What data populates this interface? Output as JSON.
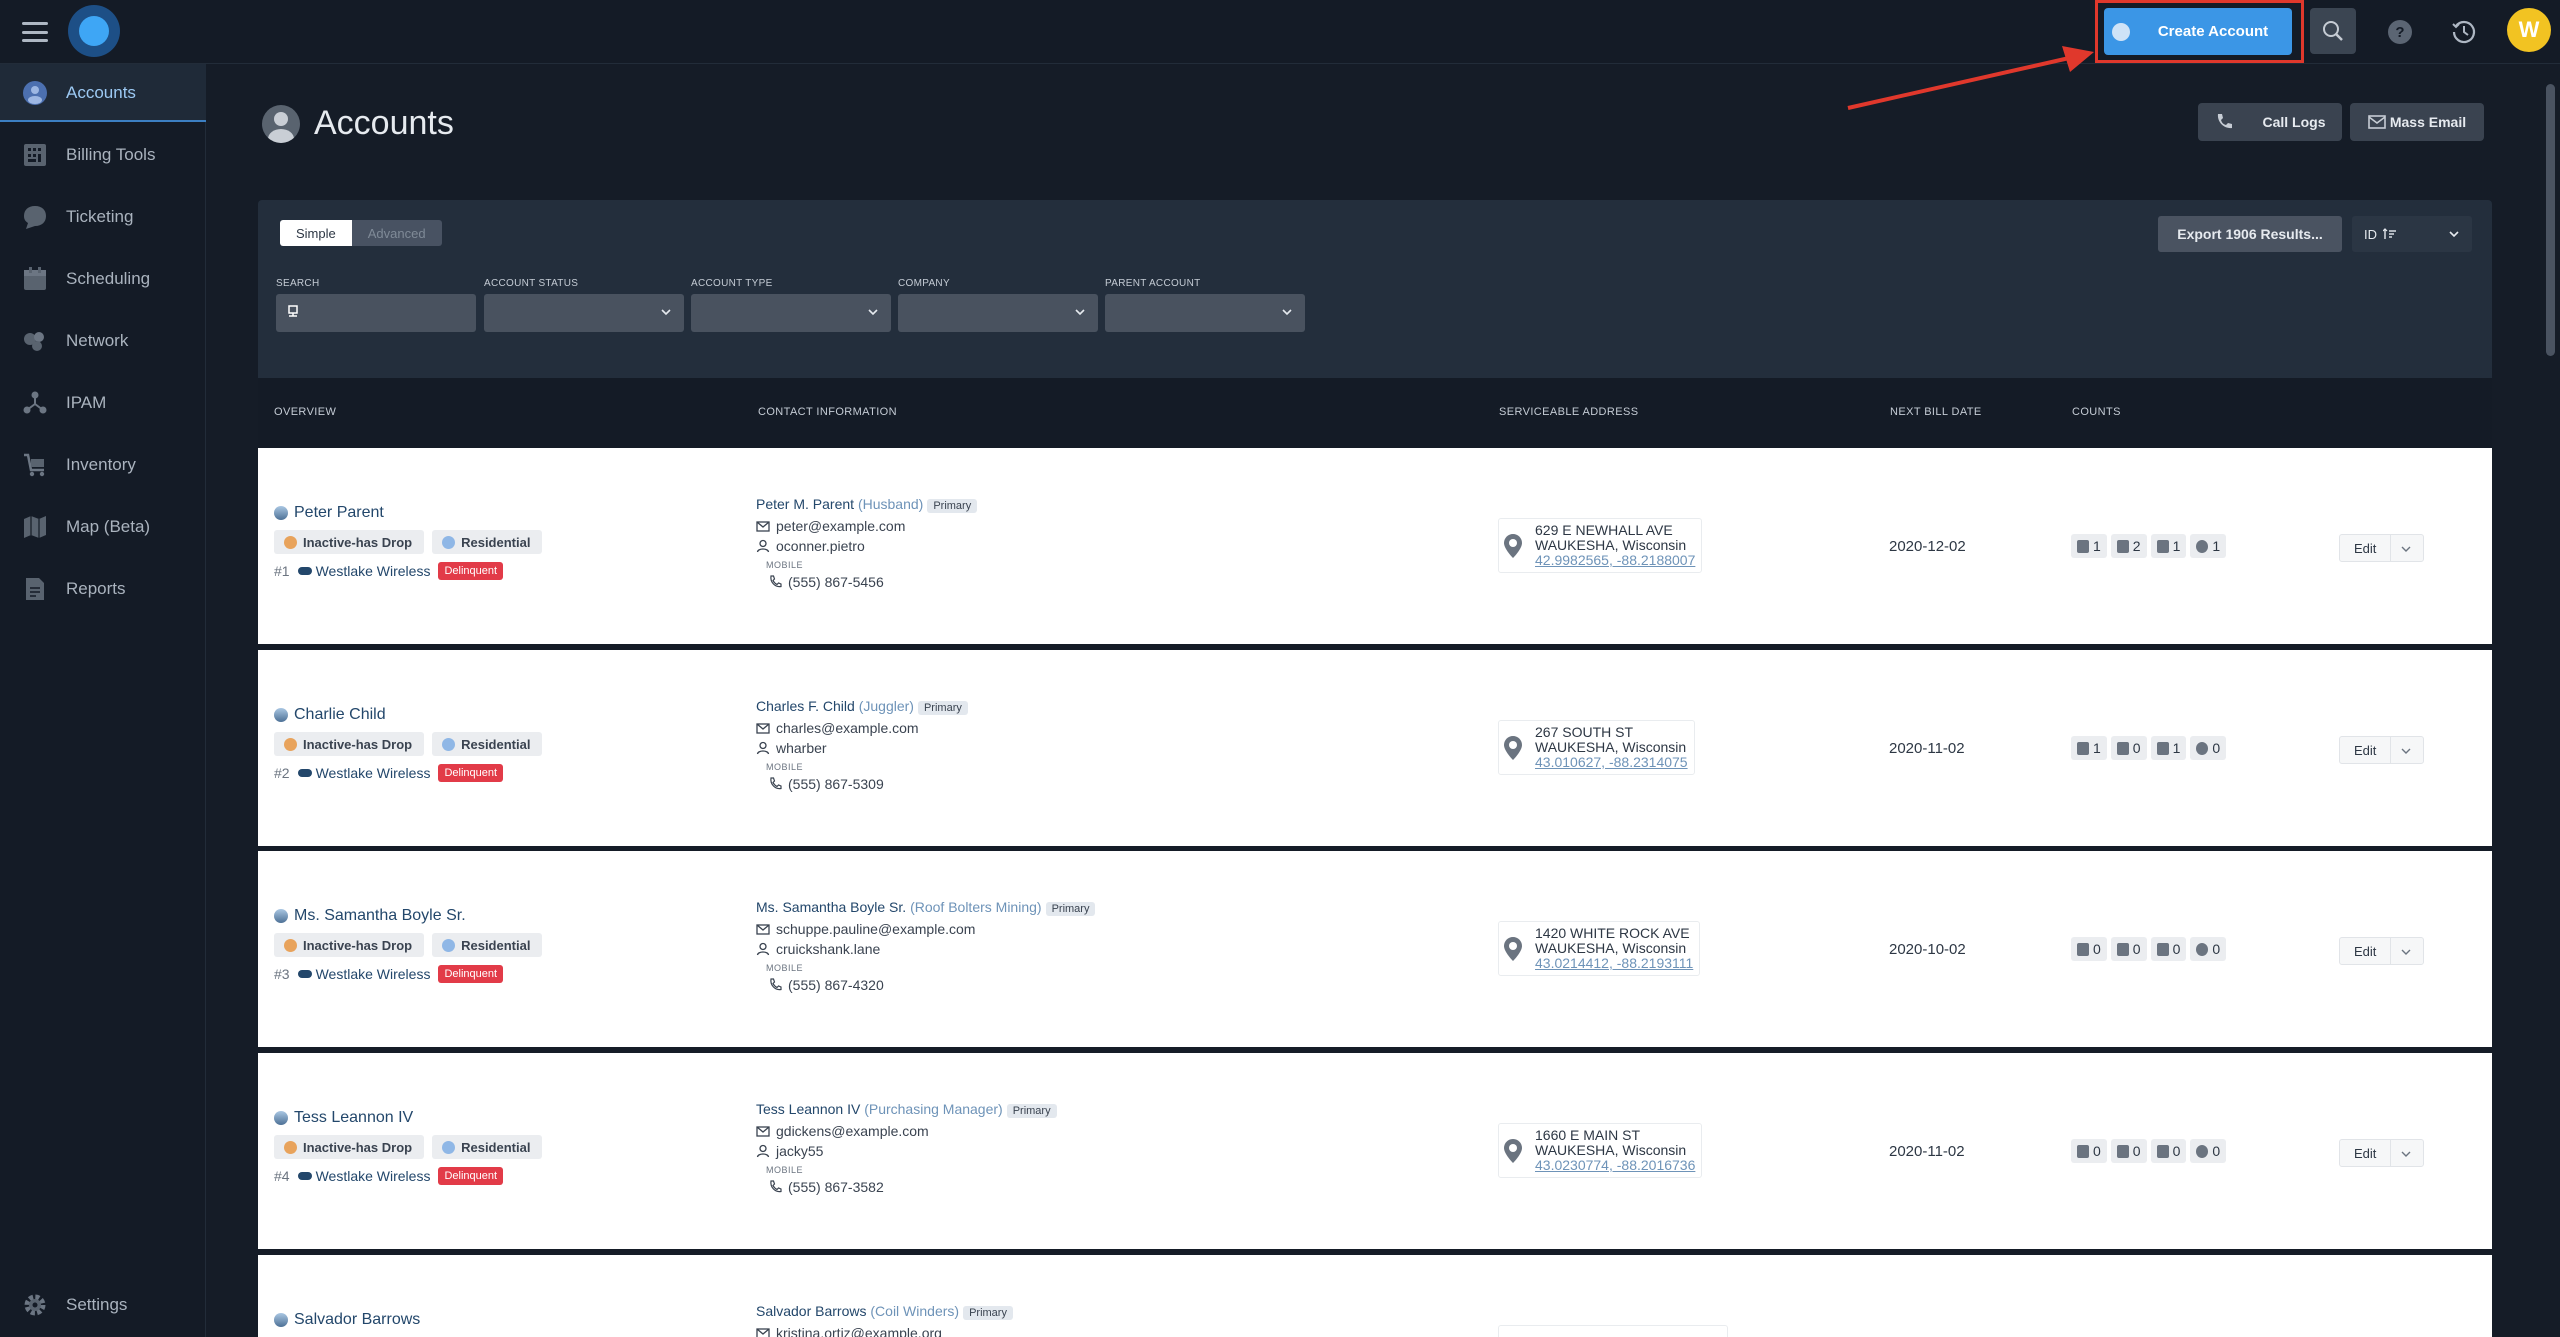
{
  "topbar": {
    "create_label": "Create Account",
    "help_label": "?",
    "avatar_initial": "W"
  },
  "sidebar": {
    "items": [
      {
        "label": "Accounts",
        "icon": "accounts-icon",
        "active": true
      },
      {
        "label": "Billing Tools",
        "icon": "billing-icon"
      },
      {
        "label": "Ticketing",
        "icon": "ticket-icon"
      },
      {
        "label": "Scheduling",
        "icon": "calendar-icon"
      },
      {
        "label": "Network",
        "icon": "network-icon"
      },
      {
        "label": "IPAM",
        "icon": "ipam-icon"
      },
      {
        "label": "Inventory",
        "icon": "cart-icon"
      },
      {
        "label": "Map (Beta)",
        "icon": "map-icon"
      },
      {
        "label": "Reports",
        "icon": "report-icon"
      }
    ],
    "settings_label": "Settings"
  },
  "page": {
    "title": "Accounts",
    "call_logs_label": "Call Logs",
    "mass_email_label": "Mass Email"
  },
  "filters": {
    "simple_label": "Simple",
    "advanced_label": "Advanced",
    "search_label": "SEARCH",
    "account_status_label": "ACCOUNT STATUS",
    "account_type_label": "ACCOUNT TYPE",
    "company_label": "COMPANY",
    "parent_account_label": "PARENT ACCOUNT",
    "export_label": "Export 1906 Results...",
    "sort_label": "ID"
  },
  "table": {
    "headers": {
      "overview": "OVERVIEW",
      "contact": "CONTACT INFORMATION",
      "address": "SERVICEABLE ADDRESS",
      "bill": "NEXT BILL DATE",
      "counts": "COUNTS"
    },
    "mobile_label": "MOBILE",
    "edit_label": "Edit",
    "rows": [
      {
        "name": "Peter Parent",
        "status": "Inactive-has Drop",
        "type": "Residential",
        "id": "#1",
        "company": "Westlake Wireless",
        "flag": "Delinquent",
        "contact_name": "Peter M. Parent",
        "relation": "(Husband)",
        "primary": "Primary",
        "email": "peter@example.com",
        "username": "oconner.pietro",
        "phone": "(555) 867-5456",
        "street": "629 E NEWHALL AVE",
        "city": "WAUKESHA, Wisconsin",
        "coords": "42.9982565, -88.2188007",
        "bill_date": "2020-12-02",
        "counts": [
          "1",
          "2",
          "1",
          "1"
        ]
      },
      {
        "name": "Charlie Child",
        "status": "Inactive-has Drop",
        "type": "Residential",
        "id": "#2",
        "company": "Westlake Wireless",
        "flag": "Delinquent",
        "contact_name": "Charles F. Child",
        "relation": "(Juggler)",
        "primary": "Primary",
        "email": "charles@example.com",
        "username": "wharber",
        "phone": "(555) 867-5309",
        "street": "267 SOUTH ST",
        "city": "WAUKESHA, Wisconsin",
        "coords": "43.010627, -88.2314075",
        "bill_date": "2020-11-02",
        "counts": [
          "1",
          "0",
          "1",
          "0"
        ]
      },
      {
        "name": "Ms. Samantha Boyle Sr.",
        "status": "Inactive-has Drop",
        "type": "Residential",
        "id": "#3",
        "company": "Westlake Wireless",
        "flag": "Delinquent",
        "contact_name": "Ms. Samantha Boyle Sr.",
        "relation": "(Roof Bolters Mining)",
        "primary": "Primary",
        "email": "schuppe.pauline@example.com",
        "username": "cruickshank.lane",
        "phone": "(555) 867-4320",
        "street": "1420 WHITE ROCK AVE",
        "city": "WAUKESHA, Wisconsin",
        "coords": "43.0214412, -88.2193111",
        "bill_date": "2020-10-02",
        "counts": [
          "0",
          "0",
          "0",
          "0"
        ]
      },
      {
        "name": "Tess Leannon IV",
        "status": "Inactive-has Drop",
        "type": "Residential",
        "id": "#4",
        "company": "Westlake Wireless",
        "flag": "Delinquent",
        "contact_name": "Tess Leannon IV",
        "relation": "(Purchasing Manager)",
        "primary": "Primary",
        "email": "gdickens@example.com",
        "username": "jacky55",
        "phone": "(555) 867-3582",
        "street": "1660 E MAIN ST",
        "city": "WAUKESHA, Wisconsin",
        "coords": "43.0230774, -88.2016736",
        "bill_date": "2020-11-02",
        "counts": [
          "0",
          "0",
          "0",
          "0"
        ]
      },
      {
        "name": "Salvador Barrows",
        "contact_name": "Salvador Barrows",
        "relation": "(Coil Winders)",
        "primary": "Primary",
        "email": "kristina.ortiz@example.org"
      }
    ]
  },
  "colors": {
    "accent": "#3b96e6",
    "highlight": "#e0382c",
    "delinquent": "#e23b48",
    "inactive_dot": "#e8a35c",
    "residential_dot": "#8fb7e6"
  }
}
